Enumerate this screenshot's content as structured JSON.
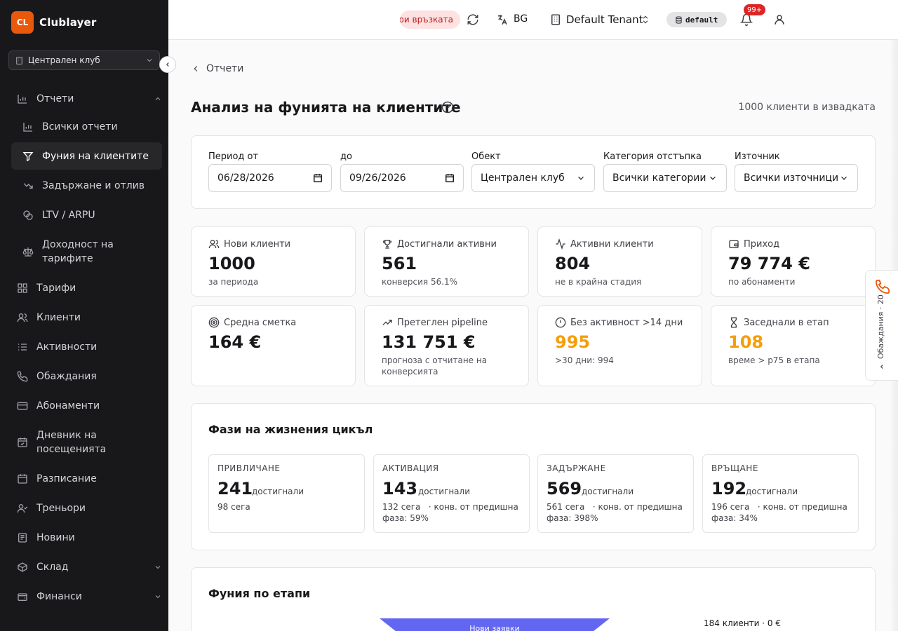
{
  "brand": {
    "logo": "CL",
    "name": "Clublayer"
  },
  "club_select": {
    "value": "Централен клуб"
  },
  "sidebar": {
    "items": [
      {
        "label": "Отчети",
        "icon": "bar-chart-icon"
      },
      {
        "label": "Всички отчети",
        "icon": "bar-chart-icon"
      },
      {
        "label": "Фуния на клиентите",
        "icon": "filter-icon"
      },
      {
        "label": "Задържане и отлив",
        "icon": "trending-down-icon"
      },
      {
        "label": "LTV / ARPU",
        "icon": "coins-icon"
      },
      {
        "label": "Доходност на",
        "label2": "тарифите",
        "icon": "scale-icon"
      },
      {
        "label": "Тарифи",
        "icon": "grid-icon"
      },
      {
        "label": "Клиенти",
        "icon": "users-icon"
      },
      {
        "label": "Активности",
        "icon": "list-icon"
      },
      {
        "label": "Обаждания",
        "icon": "phone-icon"
      },
      {
        "label": "Абонаменти",
        "icon": "card-icon"
      },
      {
        "label": "Дневник на",
        "label2": "посещенията",
        "icon": "calendar-check-icon"
      },
      {
        "label": "Разписание",
        "icon": "calendar-icon"
      },
      {
        "label": "Треньори",
        "icon": "user-check-icon"
      },
      {
        "label": "Новини",
        "icon": "newspaper-icon"
      },
      {
        "label": "Склад",
        "icon": "box-icon"
      },
      {
        "label": "Финанси",
        "icon": "wallet-icon"
      }
    ]
  },
  "header": {
    "connection": "ри връзката",
    "language": "BG",
    "tenant": "Default Tenant",
    "tenant_badge": "default",
    "notifications": "99+"
  },
  "page": {
    "back": "Отчети",
    "title": "Анализ на фунията на клиентите",
    "sample_count": "1000 клиенти в извадката"
  },
  "filters": {
    "period_from_label": "Период от",
    "period_from": "06/28/2026",
    "period_to_label": "до",
    "period_to": "09/26/2026",
    "object_label": "Обект",
    "object": "Централен клуб",
    "discount_label": "Категория отстъпка",
    "discount": "Всички категории",
    "source_label": "Източник",
    "source": "Всички източници"
  },
  "kpis": [
    {
      "label": "Нови клиенти",
      "value": "1000",
      "sub": "за периода",
      "icon": "users-icon",
      "color": "#18181b"
    },
    {
      "label": "Достигнали активни",
      "value": "561",
      "sub": "конверсия 56.1%",
      "icon": "trophy-icon",
      "color": "#18181b"
    },
    {
      "label": "Активни клиенти",
      "value": "804",
      "sub": "не в крайна стадия",
      "icon": "activity-icon",
      "color": "#18181b"
    },
    {
      "label": "Приход",
      "value": "79 774 €",
      "sub": "по абонаменти",
      "icon": "wallet-icon",
      "color": "#18181b"
    },
    {
      "label": "Средна сметка",
      "value": "164 €",
      "sub": "",
      "icon": "target-icon",
      "color": "#18181b"
    },
    {
      "label": "Претеглен pipeline",
      "value": "131 751 €",
      "sub": "прогноза с отчитане на конверсията",
      "icon": "trending-up-icon",
      "color": "#18181b"
    },
    {
      "label": "Без активност >14 дни",
      "value": "995",
      "sub": ">30 дни: 994",
      "icon": "alert-circle-icon",
      "color": "#f59e0b"
    },
    {
      "label": "Заседнали в етап",
      "value": "108",
      "sub": "време > p75 в етапа",
      "icon": "hourglass-icon",
      "color": "#f59e0b"
    }
  ],
  "lifecycle": {
    "title": "Фази на жизнения цикъл",
    "phases": [
      {
        "name": "ПРИВЛИЧАНЕ",
        "value": "241",
        "reached": "достигнали",
        "now": "98 сега",
        "conv": ""
      },
      {
        "name": "АКТИВАЦИЯ",
        "value": "143",
        "reached": "достигнали",
        "now": "132 сега",
        "conv": "· конв. от предишна фаза: 59%"
      },
      {
        "name": "ЗАДЪРЖАНЕ",
        "value": "569",
        "reached": "достигнали",
        "now": "561 сега",
        "conv": "· конв. от предишна фаза: 398%"
      },
      {
        "name": "ВРЪЩАНЕ",
        "value": "192",
        "reached": "достигнали",
        "now": "196 сега",
        "conv": "· конв. от предишна фаза: 34%"
      }
    ]
  },
  "funnel": {
    "title": "Фуния по етапи",
    "first_stage": "Нови заявки",
    "first_stat": "184 клиенти · 0 €",
    "color": "#6366f1"
  },
  "calls_tab": {
    "label": "Обаждания · 20"
  }
}
